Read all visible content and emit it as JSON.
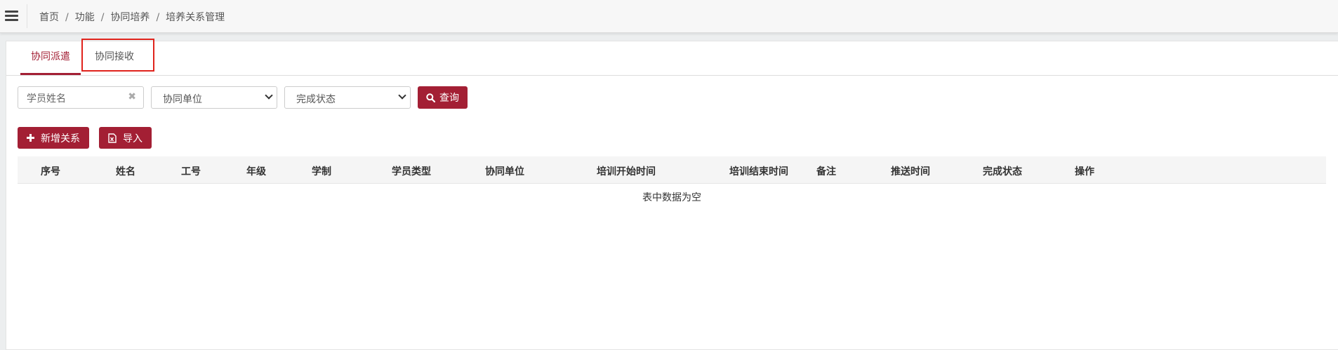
{
  "breadcrumb": [
    "首页",
    "功能",
    "协同培养",
    "培养关系管理"
  ],
  "breadcrumb_separator": "/",
  "tabs": [
    {
      "label": "协同派遣",
      "active": true
    },
    {
      "label": "协同接收",
      "active": false
    }
  ],
  "filters": {
    "name_placeholder": "学员姓名",
    "unit_select": "协同单位",
    "status_select": "完成状态",
    "search_label": "查询"
  },
  "actions": {
    "add_label": "新增关系",
    "import_label": "导入"
  },
  "table": {
    "columns": [
      "序号",
      "姓名",
      "工号",
      "年级",
      "学制",
      "学员类型",
      "协同单位",
      "培训开始时间",
      "培训结束时间",
      "备注",
      "推送时间",
      "完成状态",
      "操作"
    ],
    "empty_text": "表中数据为空"
  },
  "colors": {
    "accent": "#a31f34",
    "highlight_border": "#e0231c"
  },
  "icons": {
    "menu": "hamburger-icon",
    "clear": "close-icon",
    "search": "search-icon",
    "add": "plus-icon",
    "import": "excel-file-icon"
  }
}
